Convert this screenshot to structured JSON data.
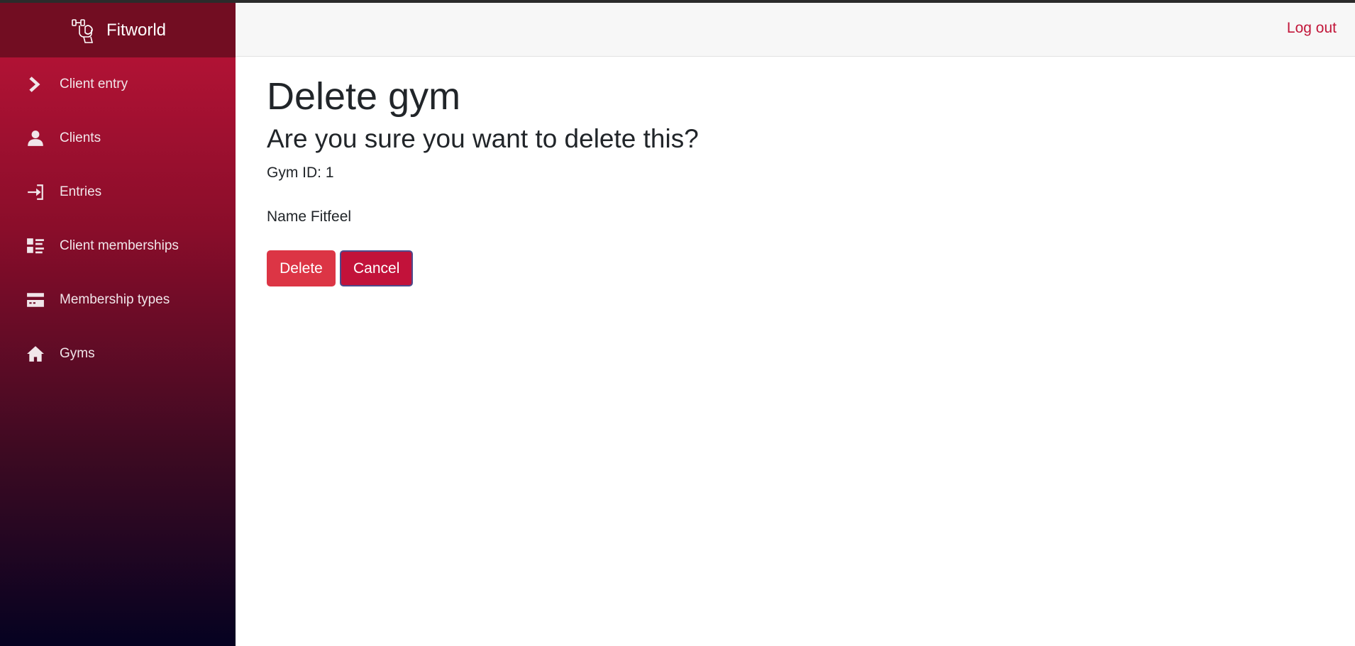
{
  "app": {
    "name": "Fitworld",
    "logo_icon": "fitness-logo-icon"
  },
  "sidebar": {
    "items": [
      {
        "label": "Client entry",
        "icon": "chevron-right-icon"
      },
      {
        "label": "Clients",
        "icon": "person-icon"
      },
      {
        "label": "Entries",
        "icon": "sign-in-icon"
      },
      {
        "label": "Client memberships",
        "icon": "list-view-icon"
      },
      {
        "label": "Membership types",
        "icon": "card-icon"
      },
      {
        "label": "Gyms",
        "icon": "home-icon"
      }
    ]
  },
  "header": {
    "logout_label": "Log out"
  },
  "main": {
    "title": "Delete gym",
    "confirm_text": "Are you sure you want to delete this?",
    "gym_id_label": "Gym ID: 1",
    "name_label": "Name Fitfeel",
    "delete_label": "Delete",
    "cancel_label": "Cancel"
  },
  "colors": {
    "accent": "#c2173a",
    "delete_button": "#dc3545",
    "cancel_button": "#c2123a",
    "sidebar_top": "#bd1438",
    "sidebar_bottom": "#050221"
  }
}
